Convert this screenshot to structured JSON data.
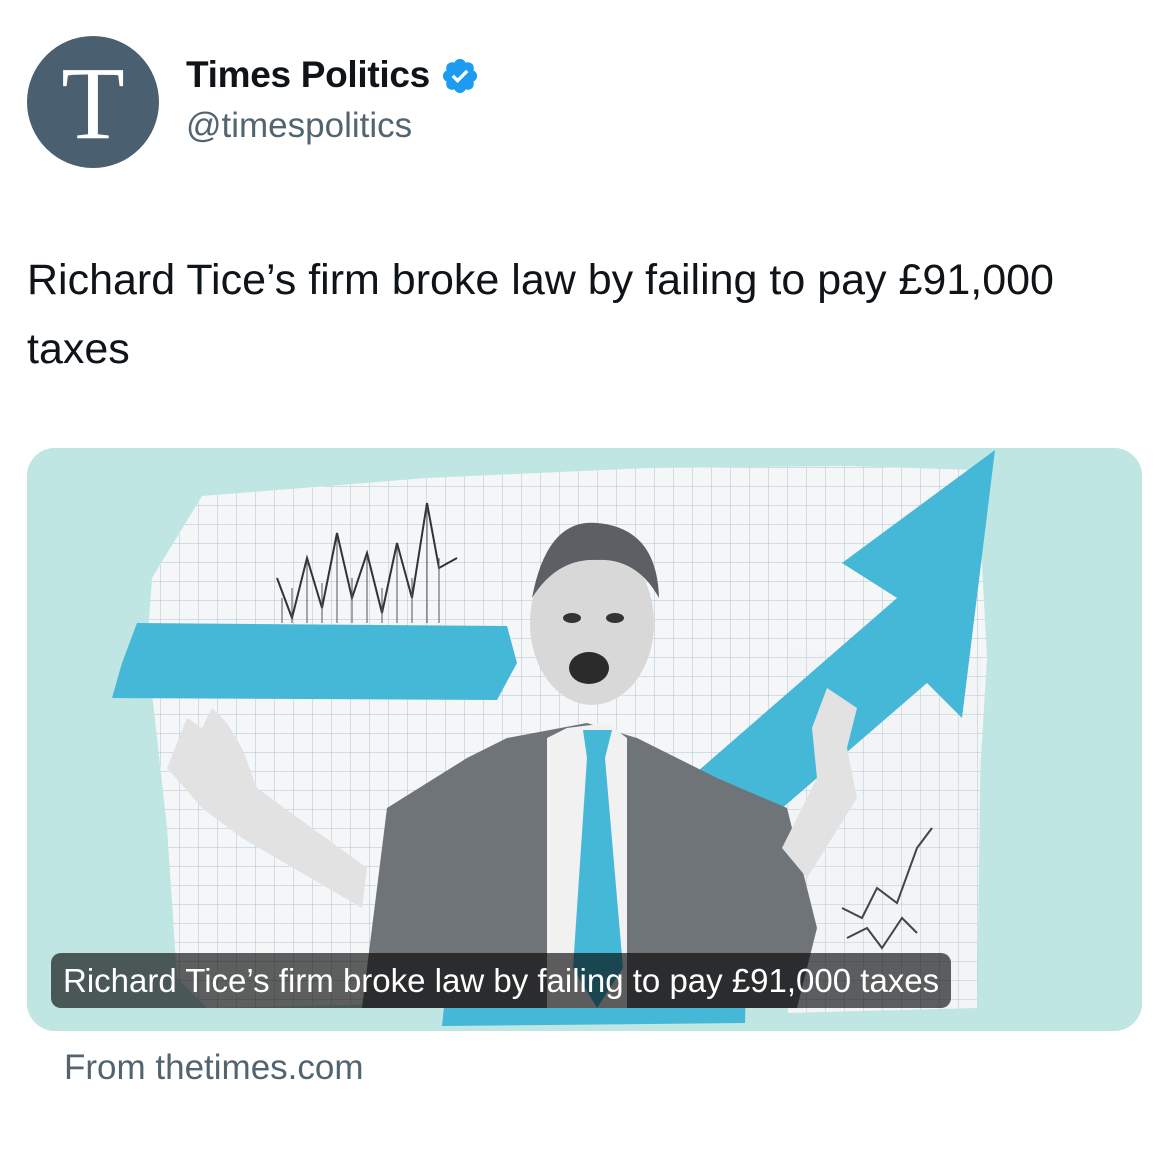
{
  "author": {
    "avatar_letter": "T",
    "display_name": "Times Politics",
    "handle": "@timespolitics",
    "verified_icon": "verified-badge-icon",
    "verified_color": "#1d9bf0",
    "avatar_color": "#4a5f70"
  },
  "tweet": {
    "text": "Richard Tice’s firm broke law by failing to pay £91,000 taxes"
  },
  "card": {
    "caption": "Richard Tice’s firm broke law by failing to pay £91,000 taxes",
    "source": "From thetimes.com",
    "accent_color": "#45b8d8",
    "background_color": "#bfe6e2"
  }
}
